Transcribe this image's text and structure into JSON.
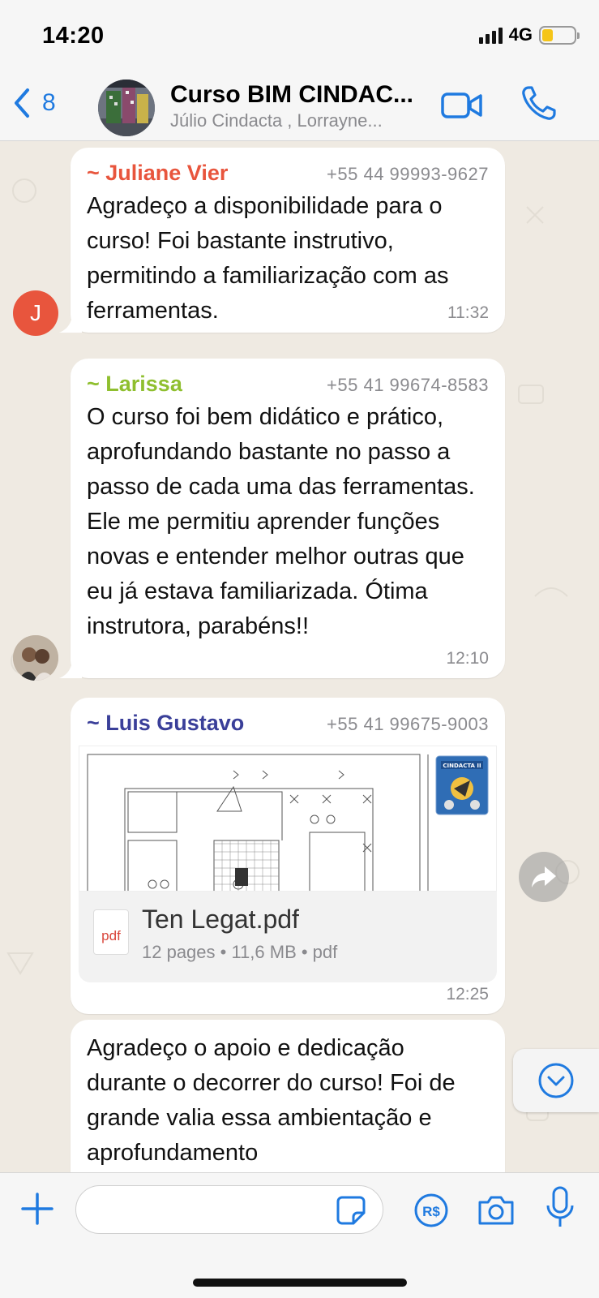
{
  "status_bar": {
    "time": "14:20",
    "network": "4G",
    "battery_level": 0.35
  },
  "header": {
    "back_count": "8",
    "title": "Curso BIM CINDAC...",
    "subtitle": "Júlio Cindacta , Lorrayne...",
    "accent_color": "#1f7ae0"
  },
  "messages": [
    {
      "sender": "~ Juliane Vier",
      "sender_color": "#e8553d",
      "phone": "+55 44 99993-9627",
      "text": "Agradeço a disponibilidade para o curso! Foi bastante instrutivo, permitindo a familiarização com as ferramentas.",
      "time": "11:32",
      "avatar_initial": "J",
      "avatar_color": "#e8553d"
    },
    {
      "sender": "~ Larissa",
      "sender_color": "#8fbf2f",
      "phone": "+55 41 99674-8583",
      "text": "O curso foi bem didático e prático, aprofundando bastante no passo a passo de cada uma das ferramentas. Ele me permitiu aprender funções novas e entender melhor outras que eu já estava familiarizada. Ótima instrutora, parabéns!!",
      "time": "12:10",
      "avatar_icon": "photo-avatar-icon"
    },
    {
      "sender": "~ Luis Gustavo",
      "sender_color": "#3a3f99",
      "phone": "+55 41 99675-9003",
      "attachment": {
        "file_name": "Ten Legat.pdf",
        "meta": "12 pages • 11,6 MB • pdf",
        "icon_label": "pdf",
        "logo_text": "CINDACTA II"
      },
      "time": "12:25"
    },
    {
      "text": "Agradeço o apoio e dedicação durante o decorrer do curso! Foi de grande valia essa ambientação e aprofundamento"
    }
  ],
  "composer": {
    "placeholder": "",
    "pay_label": "R$"
  }
}
